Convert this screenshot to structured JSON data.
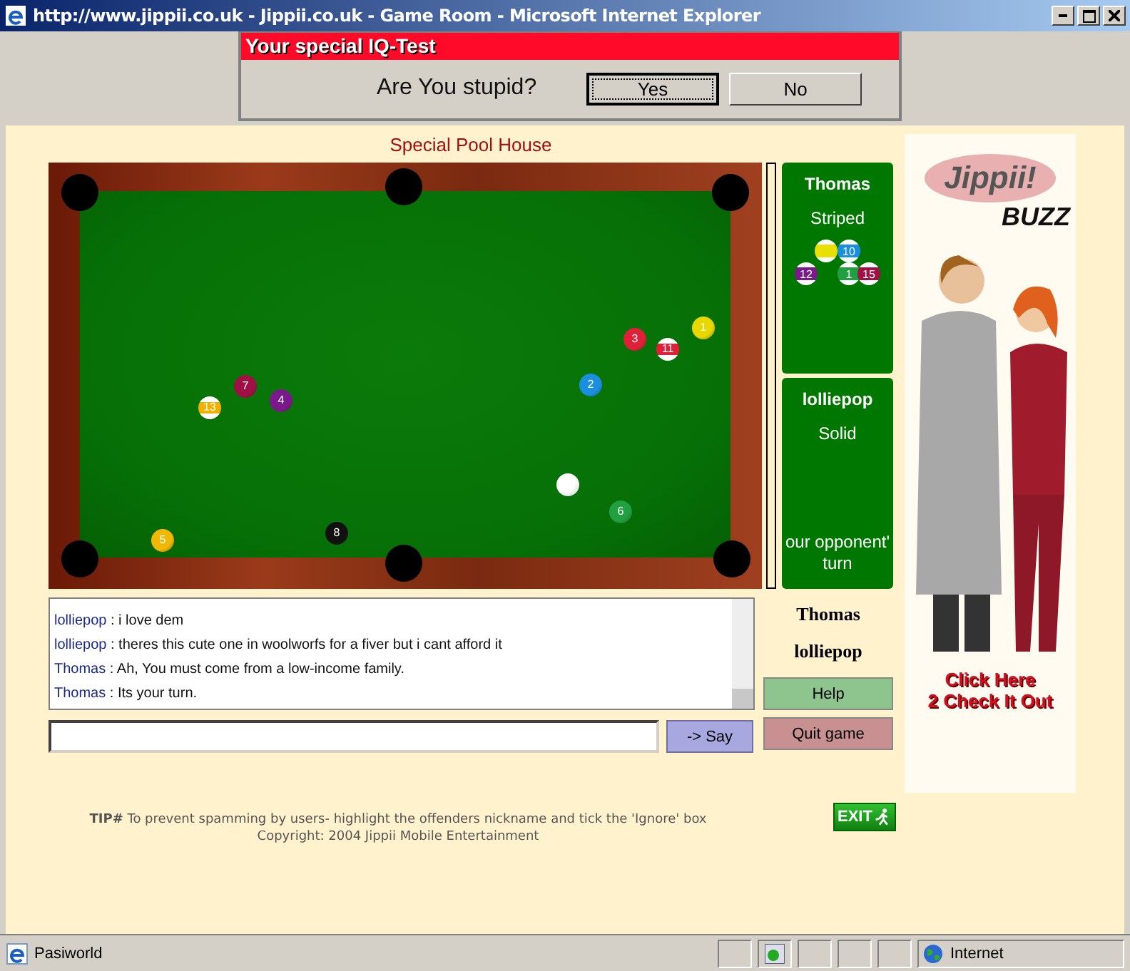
{
  "window": {
    "title": "http://www.jippii.co.uk - Jippii.co.uk - Game Room - Microsoft Internet Explorer"
  },
  "popup": {
    "title": "Your special IQ-Test",
    "question": "Are You stupid?",
    "buttons": [
      {
        "label": "Yes",
        "selected": true
      },
      {
        "label": "No",
        "selected": false
      }
    ]
  },
  "game": {
    "title": "Special Pool House",
    "balls": [
      {
        "number": "1",
        "color": "#e8d800",
        "kind": "solid"
      },
      {
        "number": "3",
        "color": "#e02038",
        "kind": "solid"
      },
      {
        "number": "11",
        "color": "#e02038",
        "kind": "striped"
      },
      {
        "number": "2",
        "color": "#1a8fe0",
        "kind": "solid"
      },
      {
        "number": "7",
        "color": "#a01044",
        "kind": "solid"
      },
      {
        "number": "4",
        "color": "#7a1a8a",
        "kind": "solid"
      },
      {
        "number": "13",
        "color": "#f0b000",
        "kind": "striped"
      },
      {
        "color": "#ffffff",
        "kind": "cue"
      },
      {
        "number": "6",
        "color": "#20a040",
        "kind": "solid"
      },
      {
        "number": "5",
        "color": "#f0b800",
        "kind": "solid"
      },
      {
        "number": "8",
        "color": "#111111",
        "kind": "solid"
      }
    ]
  },
  "players": [
    {
      "name": "Thomas",
      "group": "Striped",
      "potted": [
        {
          "color": "#e8e000"
        },
        {
          "number": "10",
          "color": "#1a8fe0"
        },
        {
          "number": "12",
          "color": "#7a1a8a"
        },
        {
          "number": "1",
          "color": "#20a040"
        },
        {
          "number": "15",
          "color": "#a01044"
        }
      ]
    },
    {
      "name": "lolliepop",
      "group": "Solid",
      "status": "our opponent' turn"
    }
  ],
  "chat": {
    "messages": [
      {
        "user": "lolliepop",
        "text": ": i love dem"
      },
      {
        "user": "lolliepop",
        "text": ": theres this cute one in woolworfs for a fiver but i cant afford it"
      },
      {
        "user": "Thomas",
        "text": ": Ah, You must come from a low-income family."
      },
      {
        "user": "Thomas",
        "text": ": Its your turn."
      }
    ],
    "say_button": "-> Say"
  },
  "names": [
    "Thomas",
    "lolliepop"
  ],
  "buttons": [
    {
      "label": "Help",
      "kind": "help"
    },
    {
      "label": "Quit game",
      "kind": "quit"
    }
  ],
  "ad": {
    "logo": "Jippii!",
    "tagline": "BUZZ",
    "cta": [
      "Click Here",
      "2 Check It Out"
    ]
  },
  "footer": {
    "tip": "**TIP#** To prevent spamming by users- highlight the offenders nickname and tick the 'Ignore' box",
    "copyright": "Copyright: 2004 Jippii Mobile Entertainment",
    "exit": "EXIT"
  },
  "status_bar": {
    "text": "Pasiworld",
    "zone": "Internet"
  }
}
